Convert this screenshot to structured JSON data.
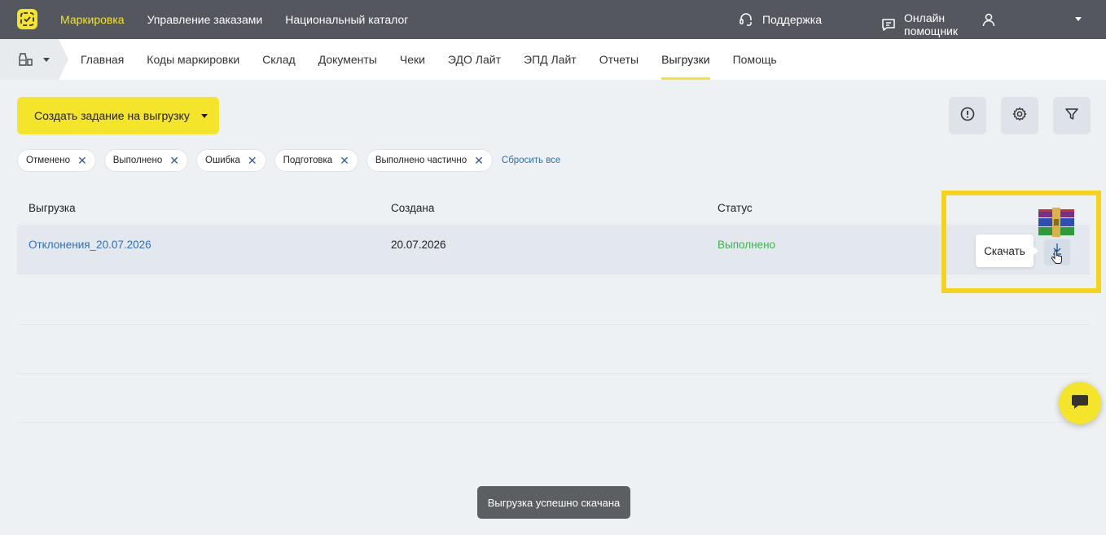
{
  "topbar": {
    "nav": [
      {
        "label": "Маркировка",
        "active": true
      },
      {
        "label": "Управление заказами",
        "active": false
      },
      {
        "label": "Национальный каталог",
        "active": false
      }
    ],
    "support_label": "Поддержка",
    "assistant_label": "Онлайн помощник",
    "accent_color": "#f4e42a"
  },
  "subnav": {
    "items": [
      {
        "label": "Главная"
      },
      {
        "label": "Коды маркировки"
      },
      {
        "label": "Склад"
      },
      {
        "label": "Документы"
      },
      {
        "label": "Чеки"
      },
      {
        "label": "ЭДО Лайт"
      },
      {
        "label": "ЭПД Лайт"
      },
      {
        "label": "Отчеты"
      },
      {
        "label": "Выгрузки",
        "active": true
      },
      {
        "label": "Помощь"
      }
    ]
  },
  "toolbar": {
    "create_label": "Создать задание на выгрузку"
  },
  "filters": {
    "chips": [
      "Отменено",
      "Выполнено",
      "Ошибка",
      "Подготовка",
      "Выполнено частично"
    ],
    "reset_label": "Сбросить все"
  },
  "table": {
    "columns": [
      "Выгрузка",
      "Создана",
      "Статус"
    ],
    "rows": [
      {
        "name": "Отклонения_20.07.2026",
        "created": "20.07.2026",
        "status": "Выполнено"
      }
    ]
  },
  "tooltip": {
    "text": "Скачать"
  },
  "toast": {
    "text": "Выгрузка успешно скачана"
  },
  "colors": {
    "status_done": "#3bb54a",
    "link": "#2f6fb6",
    "highlight": "#f5d31a"
  }
}
